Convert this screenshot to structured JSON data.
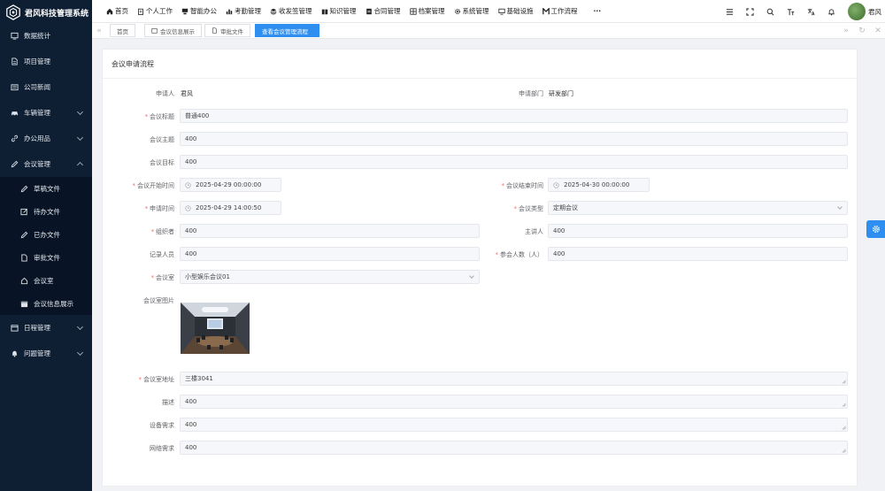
{
  "app": {
    "title": "君风科技管理系统"
  },
  "sidebar": {
    "items": [
      {
        "label": "数据统计",
        "icon": "dashboard-icon"
      },
      {
        "label": "项目管理",
        "icon": "document-icon"
      },
      {
        "label": "公司新闻",
        "icon": "news-icon"
      },
      {
        "label": "车辆管理",
        "icon": "car-icon"
      },
      {
        "label": "办公用品",
        "icon": "link-icon"
      },
      {
        "label": "会议管理",
        "icon": "pencil-icon"
      }
    ],
    "submenu": [
      {
        "label": "草稿文件"
      },
      {
        "label": "待办文件"
      },
      {
        "label": "已办文件"
      },
      {
        "label": "审批文件"
      },
      {
        "label": "会议室"
      },
      {
        "label": "会议信息展示"
      }
    ],
    "bottom": [
      {
        "label": "日程管理"
      },
      {
        "label": "问题管理"
      }
    ]
  },
  "topnav": {
    "items": [
      {
        "label": "首页"
      },
      {
        "label": "个人工作"
      },
      {
        "label": "智能办公"
      },
      {
        "label": "考勤管理"
      },
      {
        "label": "收发签管理"
      },
      {
        "label": "知识管理"
      },
      {
        "label": "合同管理"
      },
      {
        "label": "档案管理"
      },
      {
        "label": "系统管理"
      },
      {
        "label": "基础设施"
      },
      {
        "label": "工作流程"
      }
    ],
    "more": "···",
    "user": "君风"
  },
  "tags": {
    "items": [
      {
        "label": "首页"
      },
      {
        "label": "会议信息展示"
      },
      {
        "label": "审批文件"
      },
      {
        "label": "查看会议管理流程"
      }
    ]
  },
  "form": {
    "title": "会议申请流程",
    "applicant_label": "申请人",
    "applicant": "君风",
    "dept_label": "申请部门",
    "dept": "研发部门",
    "title_label": "会议标题",
    "title_value": "普通400",
    "subject_label": "会议主题",
    "subject_value": "400",
    "goal_label": "会议目标",
    "goal_value": "400",
    "start_label": "会议开始时间",
    "start_value": "2025-04-29 00:00:00",
    "end_label": "会议结束时间",
    "end_value": "2025-04-30 00:00:00",
    "apply_time_label": "申请时间",
    "apply_time_value": "2025-04-29 14:00:50",
    "type_label": "会议类型",
    "type_value": "定期会议",
    "organizer_label": "组织者",
    "organizer_value": "400",
    "speaker_label": "主讲人",
    "speaker_value": "400",
    "recorder_label": "记录人员",
    "recorder_value": "400",
    "attendees_label": "参会人数（人）",
    "attendees_value": "400",
    "room_label": "会议室",
    "room_value": "小型娱乐会议01",
    "room_img_label": "会议室图片",
    "address_label": "会议室地址",
    "address_value": "三楼3041",
    "desc_label": "描述",
    "desc_value": "400",
    "equip_label": "设备需求",
    "equip_value": "400",
    "network_label": "网络需求",
    "network_value": "400"
  },
  "colors": {
    "sidebar": "#0e1e33",
    "accent": "#2f8ff0",
    "required": "#f56c6c"
  }
}
